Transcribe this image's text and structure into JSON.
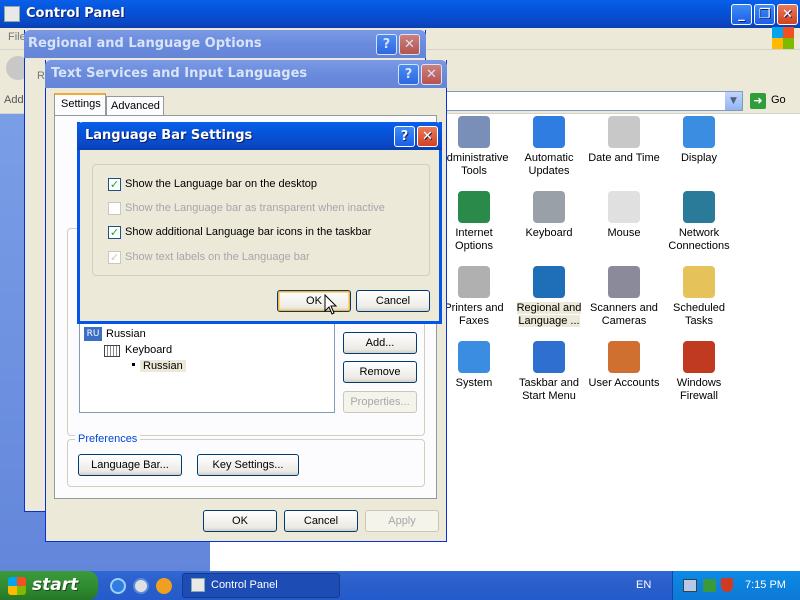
{
  "control_panel": {
    "title": "Control Panel",
    "menu_initial": "File",
    "address_label": "Addr",
    "go_label": "Go",
    "icons": [
      {
        "label": "Administrative Tools",
        "icon": "admin-tools-icon",
        "color": "#7a8fb8"
      },
      {
        "label": "Automatic Updates",
        "icon": "windows-flag-icon",
        "color": "#2f7de1"
      },
      {
        "label": "Date and Time",
        "icon": "clock-icon",
        "color": "#c8c8c8"
      },
      {
        "label": "Display",
        "icon": "monitor-icon",
        "color": "#3a8de0"
      },
      {
        "label": "Internet Options",
        "icon": "globe-icon",
        "color": "#2a8a4a"
      },
      {
        "label": "Keyboard",
        "icon": "keyboard-icon",
        "color": "#9aa0a8"
      },
      {
        "label": "Mouse",
        "icon": "mouse-icon",
        "color": "#e0e0e0"
      },
      {
        "label": "Network Connections",
        "icon": "network-globe-icon",
        "color": "#2a7a9a"
      },
      {
        "label": "Printers and Faxes",
        "icon": "printer-icon",
        "color": "#b0b0b0"
      },
      {
        "label": "Regional and Language ...",
        "icon": "globe-icon",
        "color": "#1f6fb8"
      },
      {
        "label": "Scanners and Cameras",
        "icon": "scanner-icon",
        "color": "#8a8a9a"
      },
      {
        "label": "Scheduled Tasks",
        "icon": "folder-clock-icon",
        "color": "#e6c35a"
      },
      {
        "label": "System",
        "icon": "system-icon",
        "color": "#3a8de0"
      },
      {
        "label": "Taskbar and Start Menu",
        "icon": "taskbar-icon",
        "color": "#2f6fcf"
      },
      {
        "label": "User Accounts",
        "icon": "users-icon",
        "color": "#d07030"
      },
      {
        "label": "Windows Firewall",
        "icon": "firewall-icon",
        "color": "#c03a22"
      }
    ]
  },
  "regional": {
    "title": "Regional and Language Options",
    "tab_initial": "R"
  },
  "text_services": {
    "title": "Text Services and Input Languages",
    "tabs": [
      "Settings",
      "Advanced"
    ],
    "lang_code": "RU",
    "tree": {
      "language": "Russian",
      "category": "Keyboard",
      "layout": "Russian"
    },
    "buttons": {
      "add": "Add...",
      "remove": "Remove",
      "properties": "Properties..."
    },
    "preferences_label": "Preferences",
    "language_bar_button": "Language Bar...",
    "key_settings_button": "Key Settings...",
    "ok": "OK",
    "cancel": "Cancel",
    "apply": "Apply"
  },
  "language_bar_dialog": {
    "title": "Language Bar Settings",
    "options": [
      {
        "label": "Show the Language bar on the desktop",
        "checked": true,
        "enabled": true
      },
      {
        "label": "Show the Language bar as transparent when inactive",
        "checked": false,
        "enabled": false
      },
      {
        "label": "Show additional Language bar icons in the taskbar",
        "checked": true,
        "enabled": true
      },
      {
        "label": "Show text labels on the Language bar",
        "checked": true,
        "enabled": false
      }
    ],
    "ok": "OK",
    "cancel": "Cancel"
  },
  "taskbar": {
    "start_label": "start",
    "task_label": "Control Panel",
    "language": "EN",
    "clock": "7:15 PM"
  }
}
